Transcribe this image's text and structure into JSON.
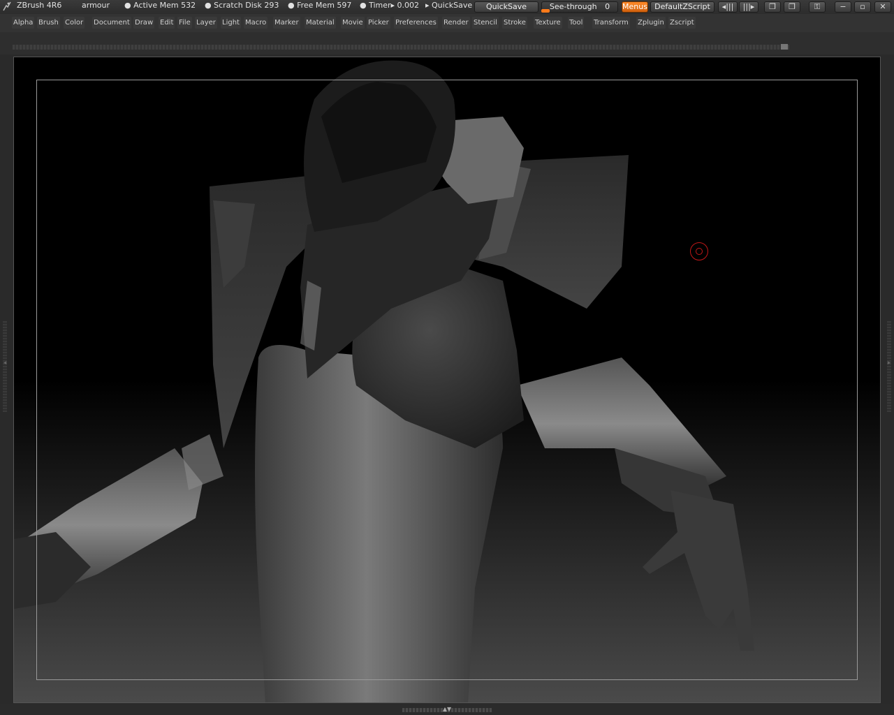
{
  "app": {
    "name": "ZBrush 4R6",
    "document": "armour",
    "active_mem": "● Active Mem 532",
    "scratch_disk": "● Scratch Disk 293",
    "free_mem": "● Free Mem 597",
    "timer": "● Timer▸ 0.002",
    "quicksave_status": "▸ QuickSave"
  },
  "toolbar": {
    "quicksave_label": "QuickSave",
    "seethrough_label": "See-through",
    "seethrough_value": "0",
    "menus_label": "Menus",
    "zscript_label": "DefaultZScript"
  },
  "window_controls": {
    "layout_prev": "◂|||",
    "layout_next": "|||▸",
    "restore_a": "❐",
    "restore_b": "❐",
    "lock": "⚿",
    "minimize": "−",
    "maximize": "▫",
    "close": "✕"
  },
  "menu": {
    "items": [
      "Alpha",
      "Brush",
      "Color",
      "Document",
      "Draw",
      "Edit",
      "File",
      "Layer",
      "Light",
      "Macro",
      "Marker",
      "Material",
      "Movie",
      "Picker",
      "Preferences",
      "Render",
      "Stencil",
      "Stroke",
      "Texture",
      "Tool",
      "Transform",
      "Zplugin",
      "Zscript"
    ]
  },
  "icons": {
    "logo": "zbrush-logo-icon",
    "cursor": "brush-cursor-icon",
    "left_tray": "left-tray-arrow-icon",
    "right_tray": "right-tray-arrow-icon",
    "bottom_tray": "bottom-tray-arrows-icon"
  },
  "colors": {
    "accent": "#e06a10",
    "menus_active": "#e8781a",
    "cursor": "#c21818"
  },
  "see_through_level": 0
}
